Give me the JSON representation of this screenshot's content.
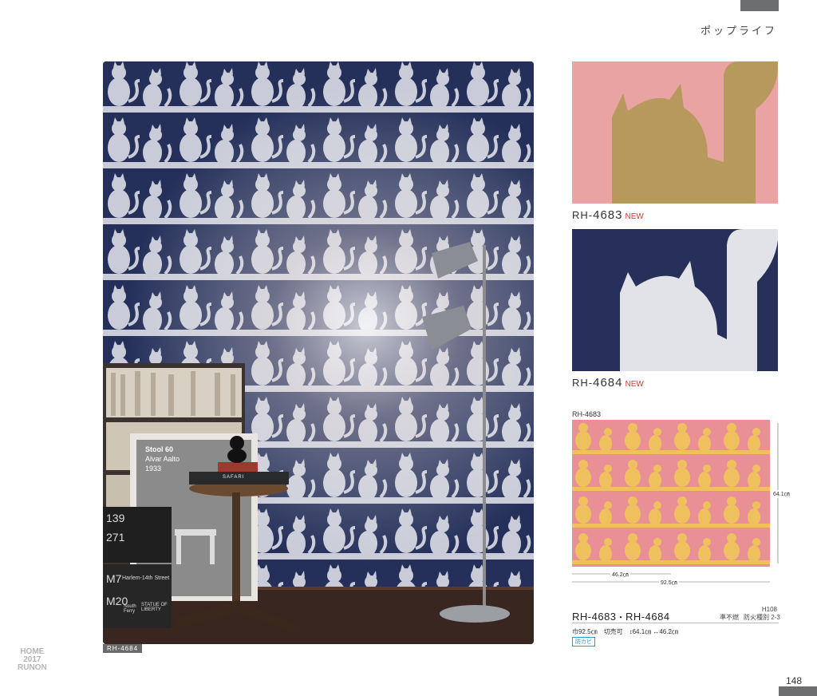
{
  "header": {
    "series_name": "ポップライフ"
  },
  "photo": {
    "label": "RH-4684",
    "stool_card": {
      "title": "Stool 60",
      "designer": "Alvar Aalto",
      "year": "1933"
    },
    "book_title": "SAFARI",
    "box_texts": [
      "139",
      "271",
      "M7",
      "M20",
      "Harlem-14th Street",
      "STATUE OF LIBERTY",
      "South Ferry"
    ]
  },
  "samples": [
    {
      "code_prefix": "RH-",
      "code_num": "4683",
      "badge": "NEW",
      "bg": "#e9a3a3",
      "cat": "#b8995d"
    },
    {
      "code_prefix": "RH-",
      "code_num": "4684",
      "badge": "NEW",
      "bg": "#27305a",
      "cat": "#e2e3e8"
    }
  ],
  "repeat": {
    "code": "RH-4683",
    "height": "64.1㎝",
    "half_width": "46.2㎝",
    "width": "92.5㎝",
    "bg": "#e98f96",
    "cat": "#efc05e"
  },
  "spec": {
    "page_code": "H108",
    "code_a": "RH-4683",
    "separator": "・",
    "code_b": "RH-4684",
    "fire_label": "準不燃",
    "fire_class": "防火種別 2-3",
    "size_text": "巾92.5㎝　切売可　↕64.1㎝ ↔46.2㎝",
    "mold_badge": "防カビ"
  },
  "footer": {
    "logo_line1": "HOME",
    "logo_line2": "2017",
    "logo_line3": "RUNON",
    "page_number": "148"
  }
}
